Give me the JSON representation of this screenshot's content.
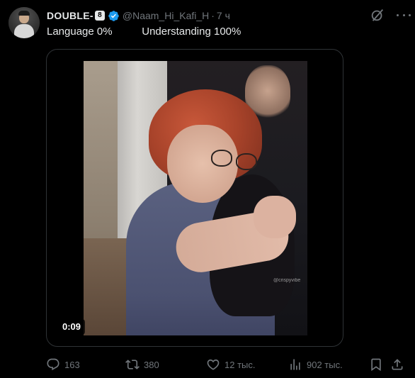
{
  "author": {
    "display_name": "DOUBLE-",
    "name_badge": "8",
    "handle": "@Naam_Hi_Kafi_H",
    "separator": "·",
    "time": "7 ч",
    "verified": true
  },
  "tweet": {
    "text": "Language 0%          Understanding 100%"
  },
  "media": {
    "duration": "0:09",
    "watermark": "@crispyvibe"
  },
  "actions": {
    "replies": "163",
    "reposts": "380",
    "likes": "12 тыс.",
    "views": "902 тыс."
  },
  "colors": {
    "background": "#000000",
    "text_primary": "#e7e9ea",
    "text_secondary": "#71767b",
    "verified_blue": "#1d9bf0",
    "border": "#2f3336"
  },
  "icons": [
    "grok-icon",
    "more-icon",
    "verified-badge-icon",
    "reply-icon",
    "repost-icon",
    "like-icon",
    "views-icon",
    "bookmark-icon",
    "share-icon"
  ]
}
